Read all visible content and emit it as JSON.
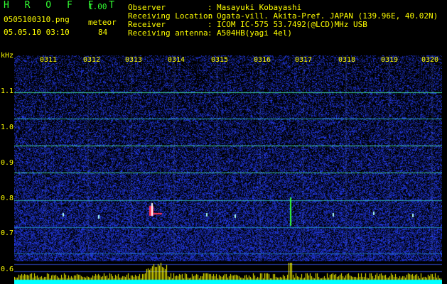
{
  "app": {
    "name": "H R O F F T",
    "version": "1.00",
    "filename": "0505100310.png",
    "datetime": "05.05.10 03:10",
    "meteor_label": "meteor",
    "meteor_count": "84"
  },
  "info": [
    {
      "label": "Observer",
      "value": "Masayuki Kobayashi"
    },
    {
      "label": "Receiving Location",
      "value": "Ogata-vill. Akita-Pref. JAPAN (139.96E, 40.02N)"
    },
    {
      "label": "Receiver",
      "value": "ICOM IC-575 53.7492(@LCD)MHz USB"
    },
    {
      "label": "Receiving antenna",
      "value": "A504HB(yagi 4el)"
    }
  ],
  "separator": ":",
  "y_axis": {
    "unit": "kHz",
    "ticks": [
      "1.1",
      "1.0",
      "0.9",
      "0.8",
      "0.7",
      "0.6"
    ]
  },
  "x_axis": {
    "ticks": [
      "0311",
      "0312",
      "0313",
      "0314",
      "0315",
      "0316",
      "0317",
      "0318",
      "0319",
      "0320"
    ]
  },
  "colors": {
    "background": "#000000",
    "label": "#ffff00",
    "title": "#33ff33",
    "noise": "#1b2a9a",
    "line": "#3ccf9a",
    "amp": "#00ffff",
    "amp_peak": "#ffff00"
  }
}
